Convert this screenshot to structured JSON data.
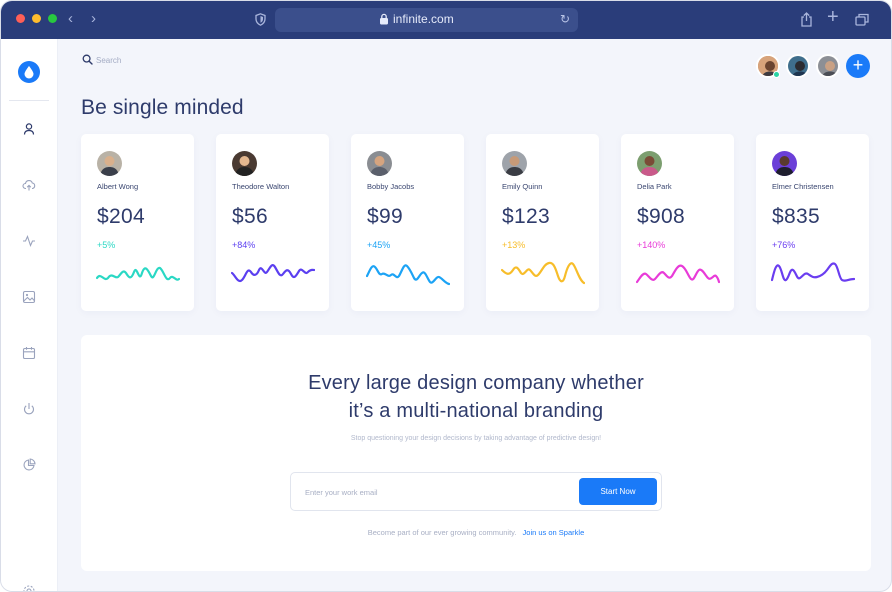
{
  "browser": {
    "url": "infinite.com"
  },
  "search": {
    "placeholder": "Search"
  },
  "page": {
    "title": "Be single minded"
  },
  "cards": [
    {
      "name": "Albert Wong",
      "amount": "$204",
      "change": "+5%",
      "color": "#2ad8c4"
    },
    {
      "name": "Theodore Walton",
      "amount": "$56",
      "change": "+84%",
      "color": "#5b3ff0"
    },
    {
      "name": "Bobby Jacobs",
      "amount": "$99",
      "change": "+45%",
      "color": "#1ca3f5"
    },
    {
      "name": "Emily Quinn",
      "amount": "$123",
      "change": "+13%",
      "color": "#f7bd2a"
    },
    {
      "name": "Delia Park",
      "amount": "$908",
      "change": "+140%",
      "color": "#e83bd8"
    },
    {
      "name": "Elmer Christensen",
      "amount": "$835",
      "change": "+76%",
      "color": "#6a3df0"
    }
  ],
  "cta": {
    "headline_line1": "Every large design company whether",
    "headline_line2": "it’s a multi-national branding",
    "subtext": "Stop questioning your design decisions by taking advantage of predictive design!",
    "email_placeholder": "Enter your work email",
    "button_label": "Start Now",
    "footer_text": "Become part of our ever growing community.",
    "footer_link": "Join us on Sparkle"
  },
  "colors": {
    "accent": "#1a7af8",
    "titlebar": "#2a3d7a",
    "text_primary": "#2e3b6b"
  },
  "icons": {
    "sidebar": [
      "user-icon",
      "cloud-upload-icon",
      "activity-icon",
      "image-icon",
      "calendar-icon",
      "power-icon",
      "pie-chart-icon",
      "settings-icon"
    ]
  }
}
